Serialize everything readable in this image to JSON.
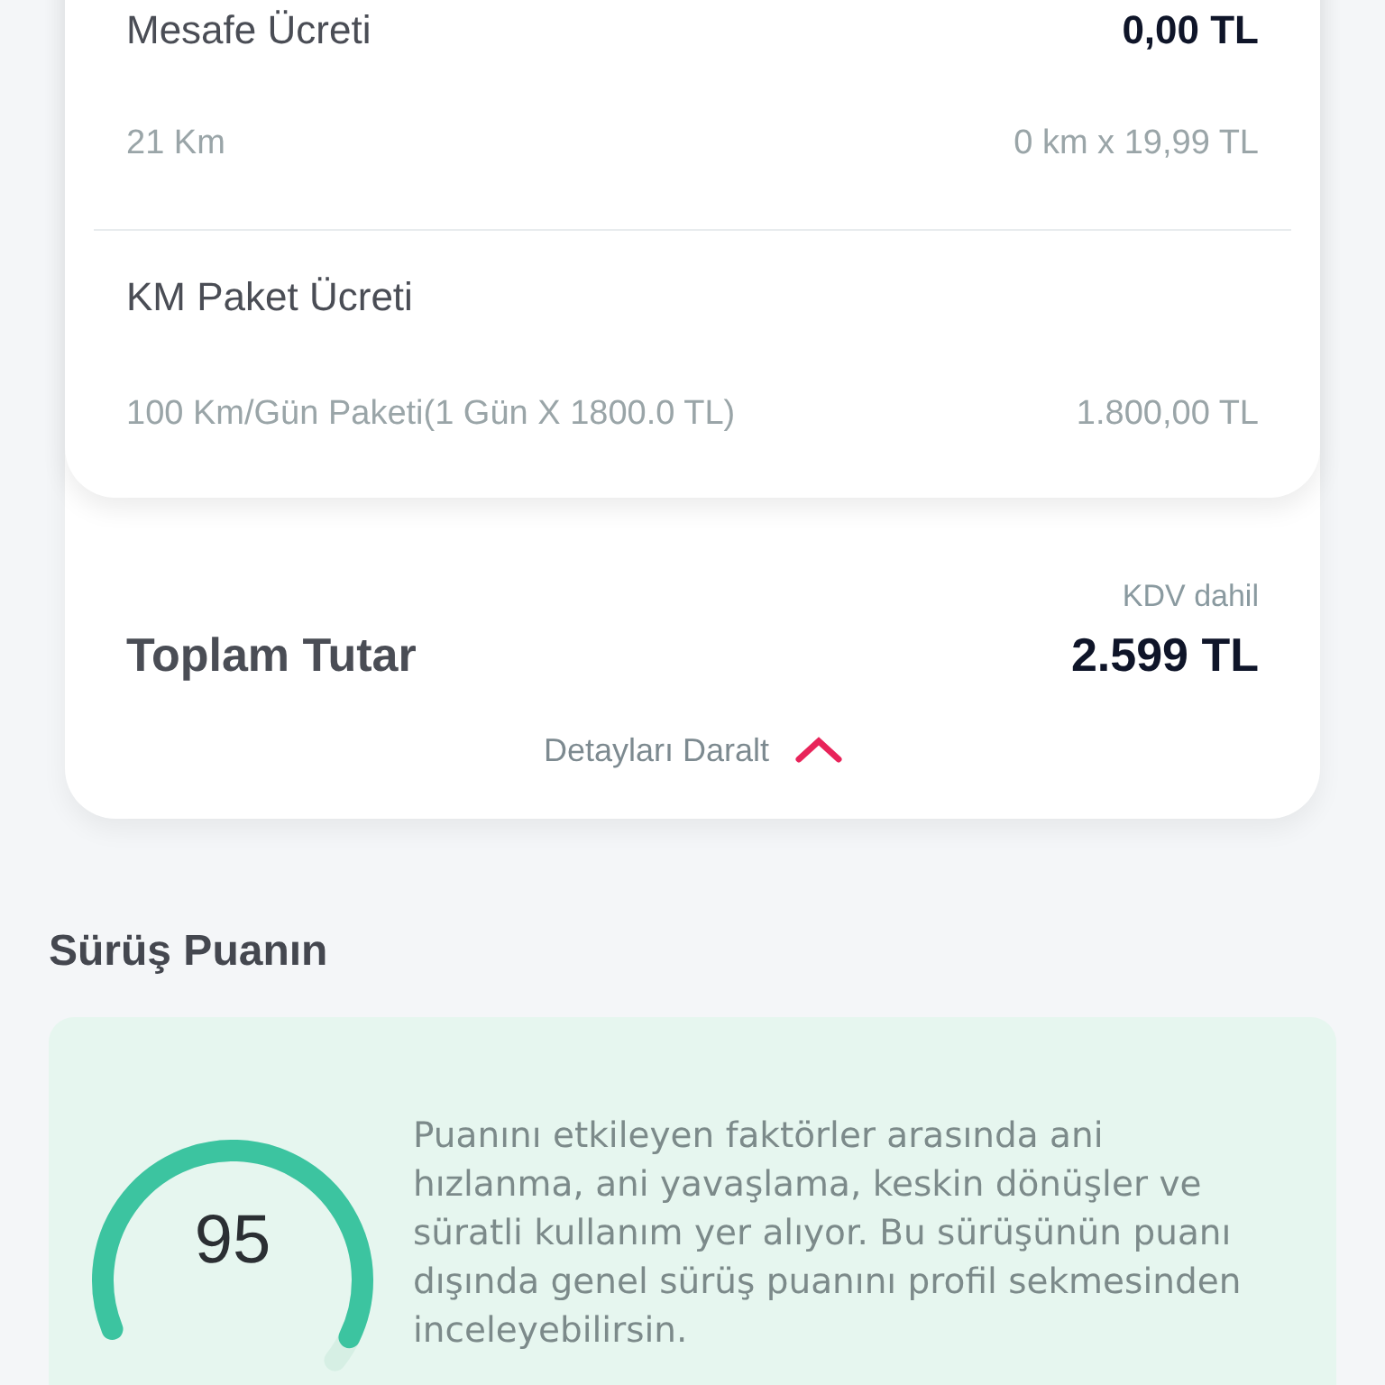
{
  "fees": [
    {
      "title": "Mesafe Ücreti",
      "amount": "0,00 TL",
      "detail": "21 Km",
      "detail_value": "0 km x 19,99 TL"
    },
    {
      "title": "KM Paket Ücreti",
      "detail": "100 Km/Gün Paketi(1 Gün X 1800.0 TL)",
      "detail_value": "1.800,00 TL"
    }
  ],
  "total": {
    "label": "Toplam Tutar",
    "note": "KDV dahil",
    "amount": "2.599 TL"
  },
  "collapse": {
    "label": "Detayları Daralt",
    "expanded": true
  },
  "score_section": {
    "title": "Sürüş Puanın",
    "score": "95",
    "level": 0.95,
    "text": "Puanını etkileyen faktörler arasında ani hızlanma, ani yavaşlama, keskin dönüşler ve süratli kullanım yer alıyor. Bu sürüşünün puanı dışında genel sürüş puanını profil sekmesinden inceleyebilirsin."
  }
}
